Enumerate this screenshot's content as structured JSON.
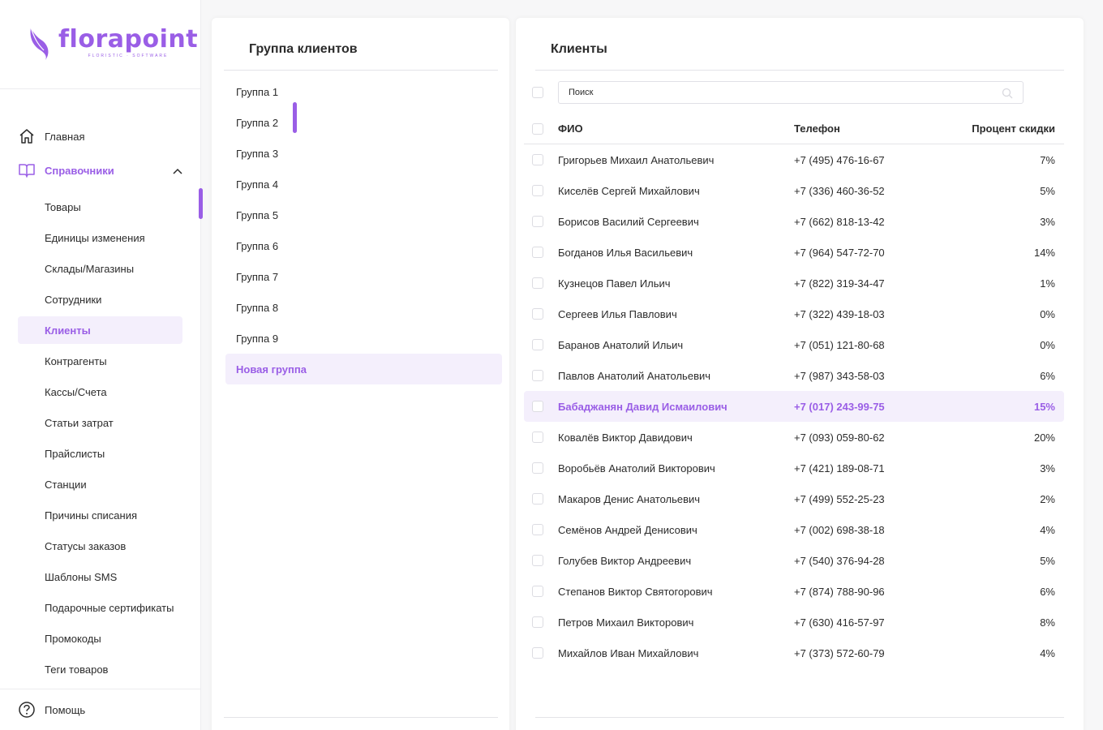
{
  "brand": {
    "name": "florapoint",
    "tagline": "FLORISTIC · SOFTWARE",
    "accent": "#9a5ee6"
  },
  "sidebar": {
    "main": {
      "label": "Главная",
      "icon": "home-icon"
    },
    "reference": {
      "label": "Справочники",
      "icon": "book-icon"
    },
    "sub_items": [
      {
        "label": "Товары"
      },
      {
        "label": "Единицы изменения"
      },
      {
        "label": "Склады/Магазины"
      },
      {
        "label": "Сотрудники"
      },
      {
        "label": "Клиенты",
        "selected": true
      },
      {
        "label": "Контрагенты"
      },
      {
        "label": "Кассы/Счета"
      },
      {
        "label": "Статьи затрат"
      },
      {
        "label": "Прайслисты"
      },
      {
        "label": "Станции"
      },
      {
        "label": "Причины списания"
      },
      {
        "label": "Статусы заказов"
      },
      {
        "label": "Шаблоны SMS"
      },
      {
        "label": "Подарочные сертификаты"
      },
      {
        "label": "Промокоды"
      },
      {
        "label": "Теги товаров"
      }
    ],
    "help": {
      "label": "Помощь",
      "icon": "help-icon"
    }
  },
  "groups": {
    "title": "Группа клиентов",
    "items": [
      {
        "label": "Группа 1"
      },
      {
        "label": "Группа 2"
      },
      {
        "label": "Группа 3"
      },
      {
        "label": "Группа 4"
      },
      {
        "label": "Группа 5"
      },
      {
        "label": "Группа 6"
      },
      {
        "label": "Группа 7"
      },
      {
        "label": "Группа 8"
      },
      {
        "label": "Группа 9"
      },
      {
        "label": "Новая группа",
        "selected": true
      }
    ]
  },
  "clients": {
    "title": "Клиенты",
    "search": {
      "placeholder": "Поиск"
    },
    "columns": {
      "name": "ФИО",
      "phone": "Телефон",
      "discount": "Процент скидки"
    },
    "rows": [
      {
        "name": "Григорьев Михаил Анатольевич",
        "phone": "+7 (495) 476-16-67",
        "discount": "7%"
      },
      {
        "name": "Киселёв Сергей Михайлович",
        "phone": "+7 (336) 460-36-52",
        "discount": "5%"
      },
      {
        "name": "Борисов Василий Сергеевич",
        "phone": "+7 (662) 818-13-42",
        "discount": "3%"
      },
      {
        "name": "Богданов Илья Васильевич",
        "phone": "+7 (964) 547-72-70",
        "discount": "14%"
      },
      {
        "name": "Кузнецов Павел Ильич",
        "phone": "+7 (822) 319-34-47",
        "discount": "1%"
      },
      {
        "name": "Сергеев Илья Павлович",
        "phone": "+7 (322) 439-18-03",
        "discount": "0%"
      },
      {
        "name": "Баранов Анатолий Ильич",
        "phone": "+7 (051) 121-80-68",
        "discount": "0%"
      },
      {
        "name": "Павлов Анатолий Анатольевич",
        "phone": "+7 (987) 343-58-03",
        "discount": "6%"
      },
      {
        "name": "Бабаджанян Давид Исмаилович",
        "phone": "+7 (017) 243-99-75",
        "discount": "15%",
        "selected": true
      },
      {
        "name": "Ковалёв Виктор Давидович",
        "phone": "+7 (093) 059-80-62",
        "discount": "20%"
      },
      {
        "name": "Воробьёв Анатолий Викторович",
        "phone": "+7 (421) 189-08-71",
        "discount": "3%"
      },
      {
        "name": "Макаров Денис Анатольевич",
        "phone": "+7 (499) 552-25-23",
        "discount": "2%"
      },
      {
        "name": "Семёнов Андрей Денисович",
        "phone": "+7 (002) 698-38-18",
        "discount": "4%"
      },
      {
        "name": "Голубев Виктор Андреевич",
        "phone": "+7 (540) 376-94-28",
        "discount": "5%"
      },
      {
        "name": "Степанов Виктор Святогорович",
        "phone": "+7 (874) 788-90-96",
        "discount": "6%"
      },
      {
        "name": "Петров Михаил Викторович",
        "phone": "+7 (630) 416-57-97",
        "discount": "8%"
      },
      {
        "name": "Михайлов Иван Михайлович",
        "phone": "+7 (373) 572-60-79",
        "discount": "4%"
      }
    ]
  }
}
